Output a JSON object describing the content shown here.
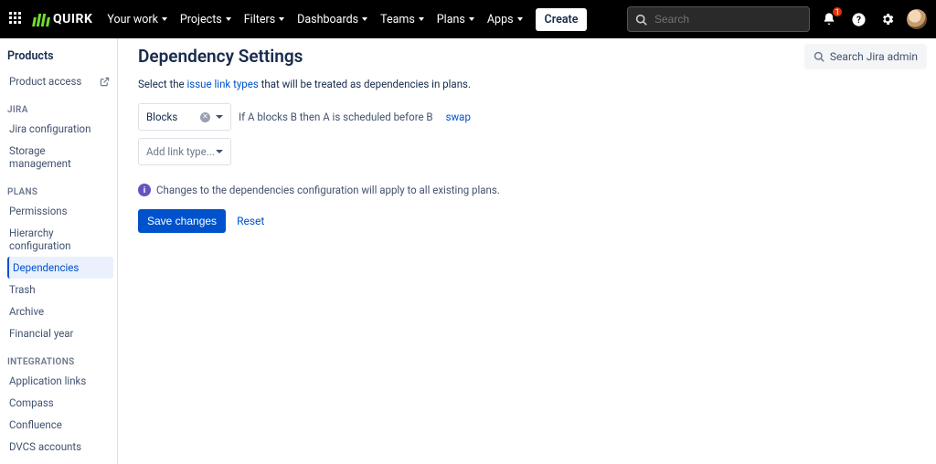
{
  "topnav": {
    "brand": "QUIRK",
    "items": [
      "Your work",
      "Projects",
      "Filters",
      "Dashboards",
      "Teams",
      "Plans",
      "Apps"
    ],
    "create": "Create",
    "search_placeholder": "Search",
    "notification_count": "1"
  },
  "sidebar": {
    "title": "Products",
    "direct": [
      {
        "label": "Product access",
        "icon": "external-link-icon"
      }
    ],
    "sections": [
      {
        "heading": "JIRA",
        "items": [
          "Jira configuration",
          "Storage management"
        ]
      },
      {
        "heading": "PLANS",
        "items": [
          "Permissions",
          "Hierarchy configuration",
          "Dependencies",
          "Trash",
          "Archive",
          "Financial year"
        ],
        "selected": "Dependencies"
      },
      {
        "heading": "INTEGRATIONS",
        "items": [
          "Application links",
          "Compass",
          "Confluence",
          "DVCS accounts"
        ]
      }
    ]
  },
  "main": {
    "title": "Dependency Settings",
    "desc_prefix": "Select the ",
    "desc_link": "issue link types",
    "desc_suffix": " that will be treated as dependencies in plans.",
    "link_type_selected": "Blocks",
    "add_link_placeholder": "Add link type...",
    "hint_text": "If A blocks B then A is scheduled before B",
    "swap_label": "swap",
    "info_text": "Changes to the dependencies configuration will apply to all existing plans.",
    "save_label": "Save changes",
    "reset_label": "Reset",
    "admin_search_label": "Search Jira admin"
  }
}
